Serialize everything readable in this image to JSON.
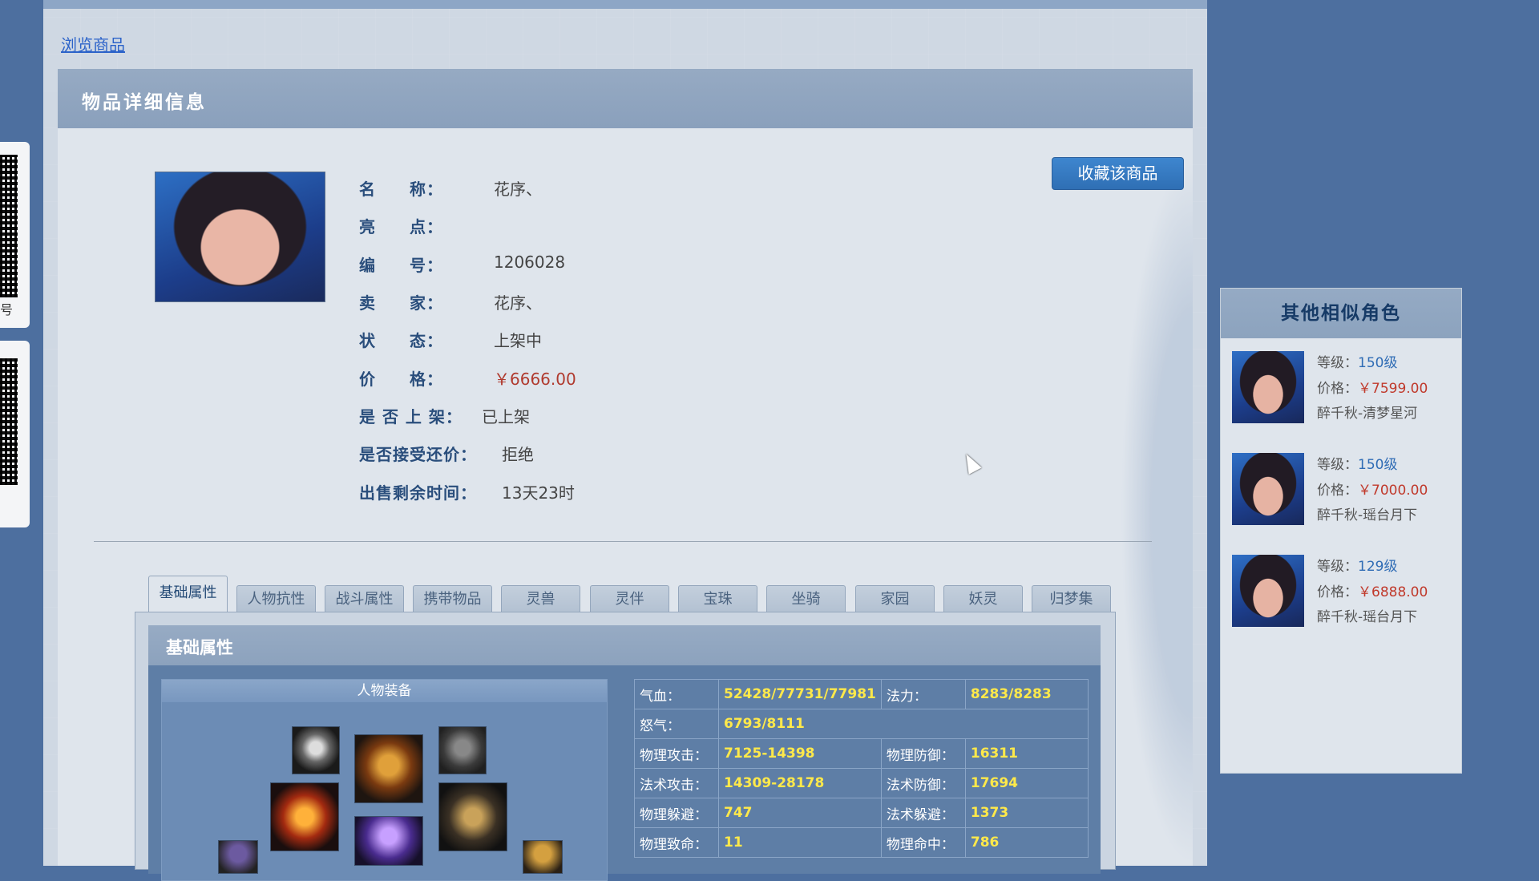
{
  "qr_tabs": [
    {
      "label": "号"
    },
    {
      "label": ""
    }
  ],
  "breadcrumb": {
    "label": "浏览商品"
  },
  "detail": {
    "title": "物品详细信息",
    "favorite_button": "收藏该商品",
    "fields": [
      {
        "label": "名　　称：",
        "value": "花序、"
      },
      {
        "label": "亮　　点：",
        "value": ""
      },
      {
        "label": "编　　号：",
        "value": "1206028"
      },
      {
        "label": "卖　　家：",
        "value": "花序、"
      },
      {
        "label": "状　　态：",
        "value": "上架中"
      },
      {
        "label": "价　　格：",
        "value": "￥6666.00"
      },
      {
        "label": "是 否 上 架：",
        "value": "已上架"
      },
      {
        "label": "是否接受还价：",
        "value": "拒绝"
      },
      {
        "label": "出售剩余时间：",
        "value": "13天23时"
      }
    ]
  },
  "tabs": [
    "基础属性",
    "人物抗性",
    "战斗属性",
    "携带物品",
    "灵兽",
    "灵伴",
    "宝珠",
    "坐骑",
    "家园",
    "妖灵",
    "归梦集"
  ],
  "attributes": {
    "title": "基础属性",
    "equipment_title": "人物装备",
    "stats": [
      [
        {
          "k": "气血：",
          "v": "52428/77731/77981"
        },
        {
          "k": "法力：",
          "v": "8283/8283"
        }
      ],
      [
        {
          "k": "怒气：",
          "v": "6793/8111"
        },
        {
          "k": "",
          "v": ""
        }
      ],
      [
        {
          "k": "物理攻击：",
          "v": "7125-14398"
        },
        {
          "k": "物理防御：",
          "v": "16311"
        }
      ],
      [
        {
          "k": "法术攻击：",
          "v": "14309-28178"
        },
        {
          "k": "法术防御：",
          "v": "17694"
        }
      ],
      [
        {
          "k": "物理躲避：",
          "v": "747"
        },
        {
          "k": "法术躲避：",
          "v": "1373"
        }
      ],
      [
        {
          "k": "物理致命：",
          "v": "11"
        },
        {
          "k": "物理命中：",
          "v": "786"
        }
      ]
    ]
  },
  "similar": {
    "title": "其他相似角色",
    "items": [
      {
        "level_label": "等级：",
        "level": "150级",
        "price_label": "价格：",
        "price": "￥7599.00",
        "server": "醉千秋-清梦星河"
      },
      {
        "level_label": "等级：",
        "level": "150级",
        "price_label": "价格：",
        "price": "￥7000.00",
        "server": "醉千秋-瑶台月下"
      },
      {
        "level_label": "等级：",
        "level": "129级",
        "price_label": "价格：",
        "price": "￥6888.00",
        "server": "醉千秋-瑶台月下"
      }
    ]
  },
  "colors": {
    "price": "#b03a2e",
    "stat_value": "#ffe94a",
    "accent_button": "#3e86cf"
  }
}
